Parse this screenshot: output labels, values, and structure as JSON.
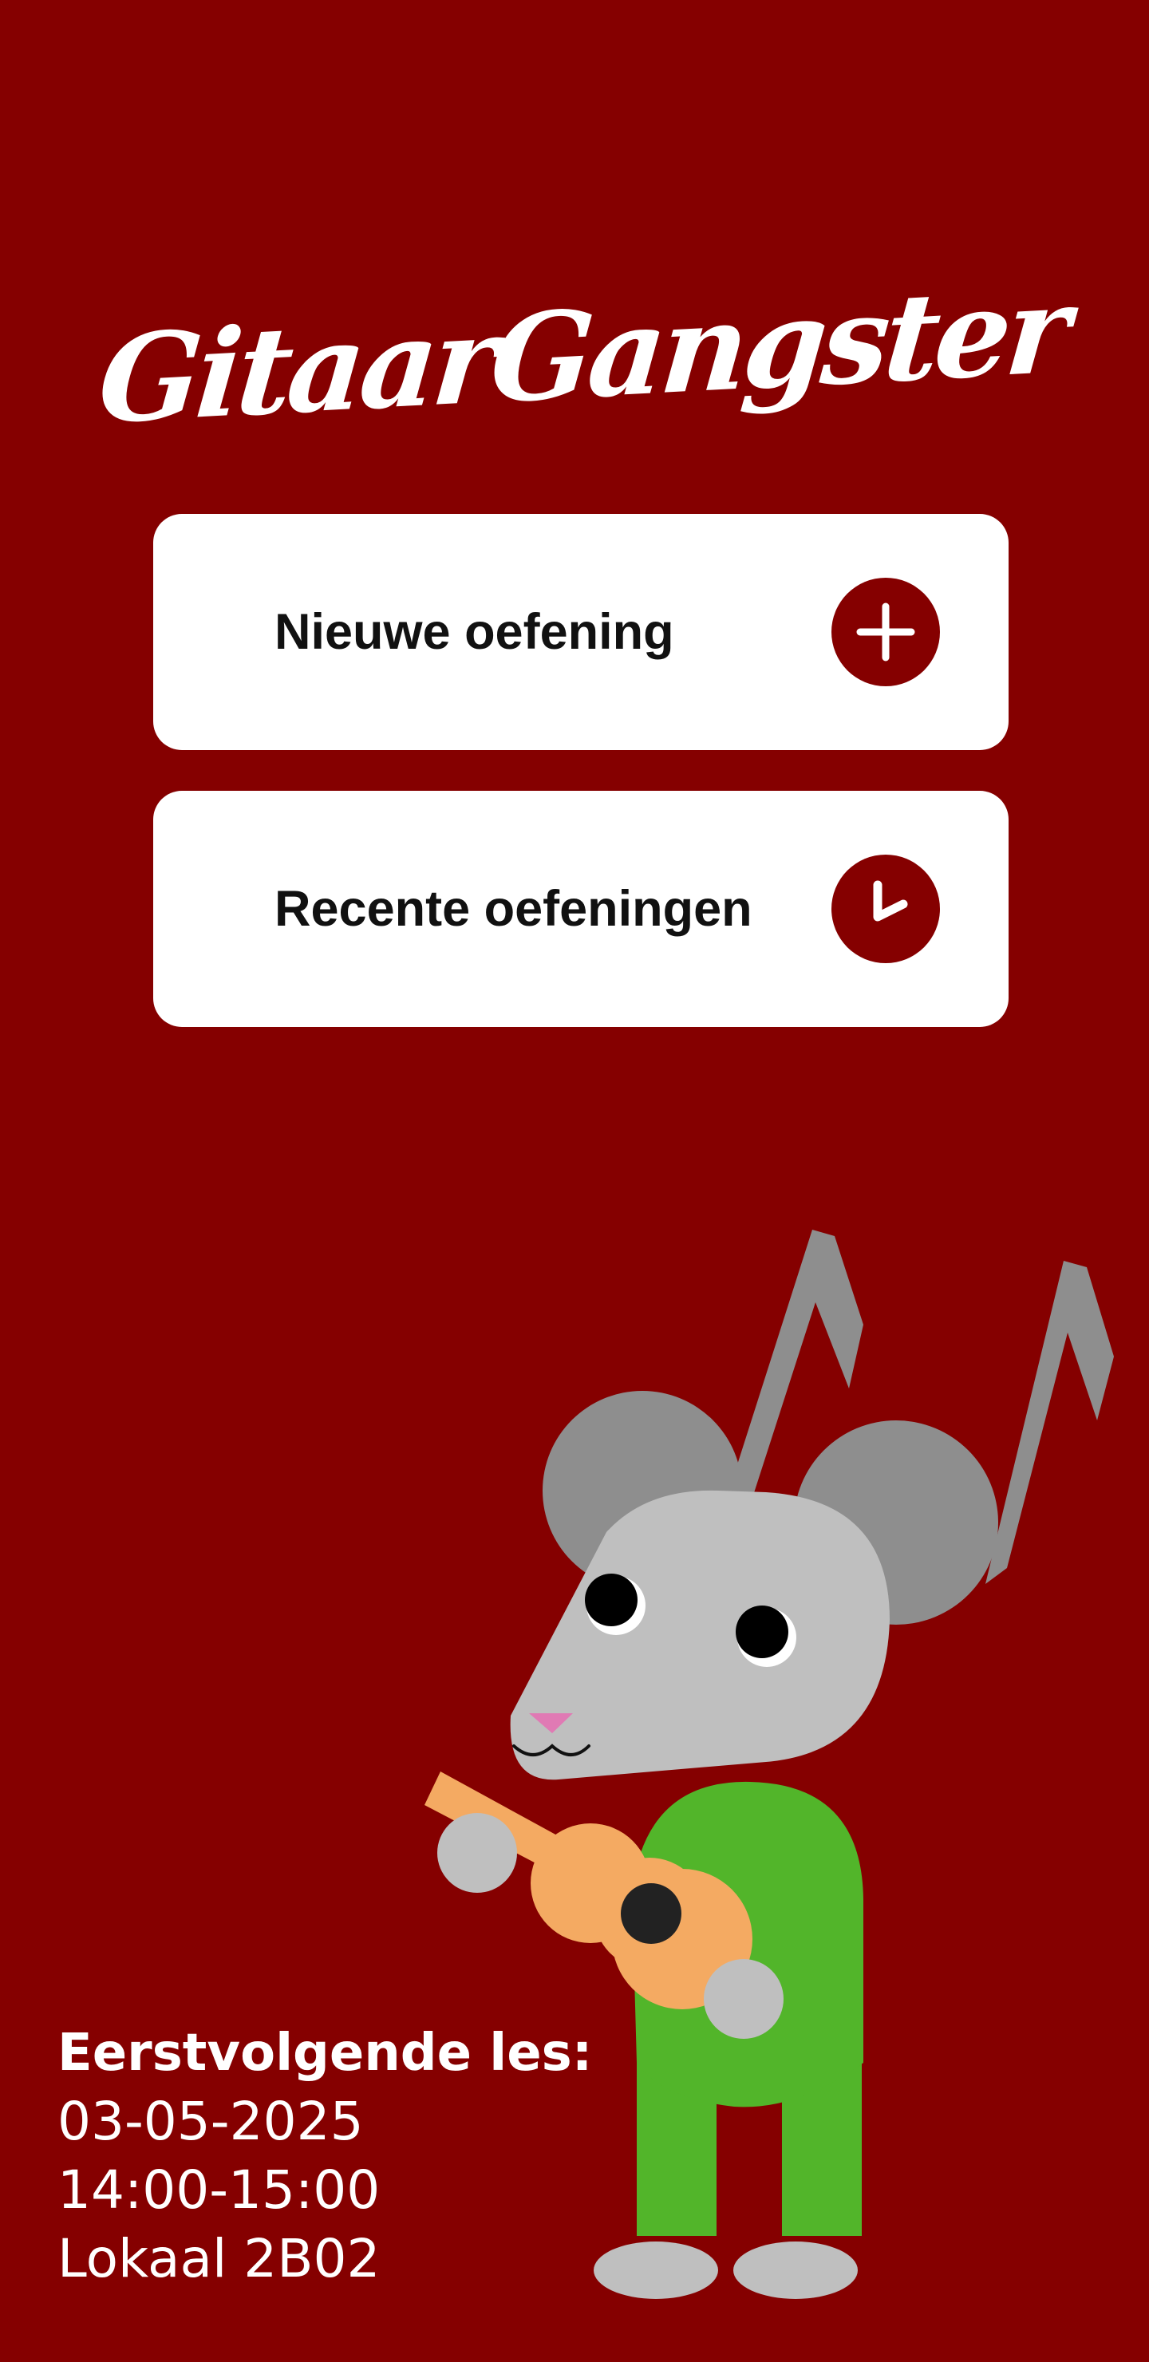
{
  "app": {
    "title": "GitaarGangster"
  },
  "menu": {
    "items": [
      {
        "label": "Nieuwe oefening",
        "icon": "plus-icon"
      },
      {
        "label": "Recente oefeningen",
        "icon": "clock-icon"
      }
    ]
  },
  "next_lesson": {
    "heading": "Eerstvolgende les:",
    "date": "03-05-2025",
    "time": "14:00-15:00",
    "room": "Lokaal 2B02"
  },
  "mascot": {
    "icon": "mouse-guitar-mascot-illustration",
    "notes_icon": "music-note-icon"
  },
  "colors": {
    "background": "#850000",
    "card": "#ffffff",
    "accent": "#850000",
    "mouse_body": "#bfbfbf",
    "mouse_ears": "#8e8e8e",
    "shirt": "#52b52a",
    "guitar": "#f4aa62"
  }
}
